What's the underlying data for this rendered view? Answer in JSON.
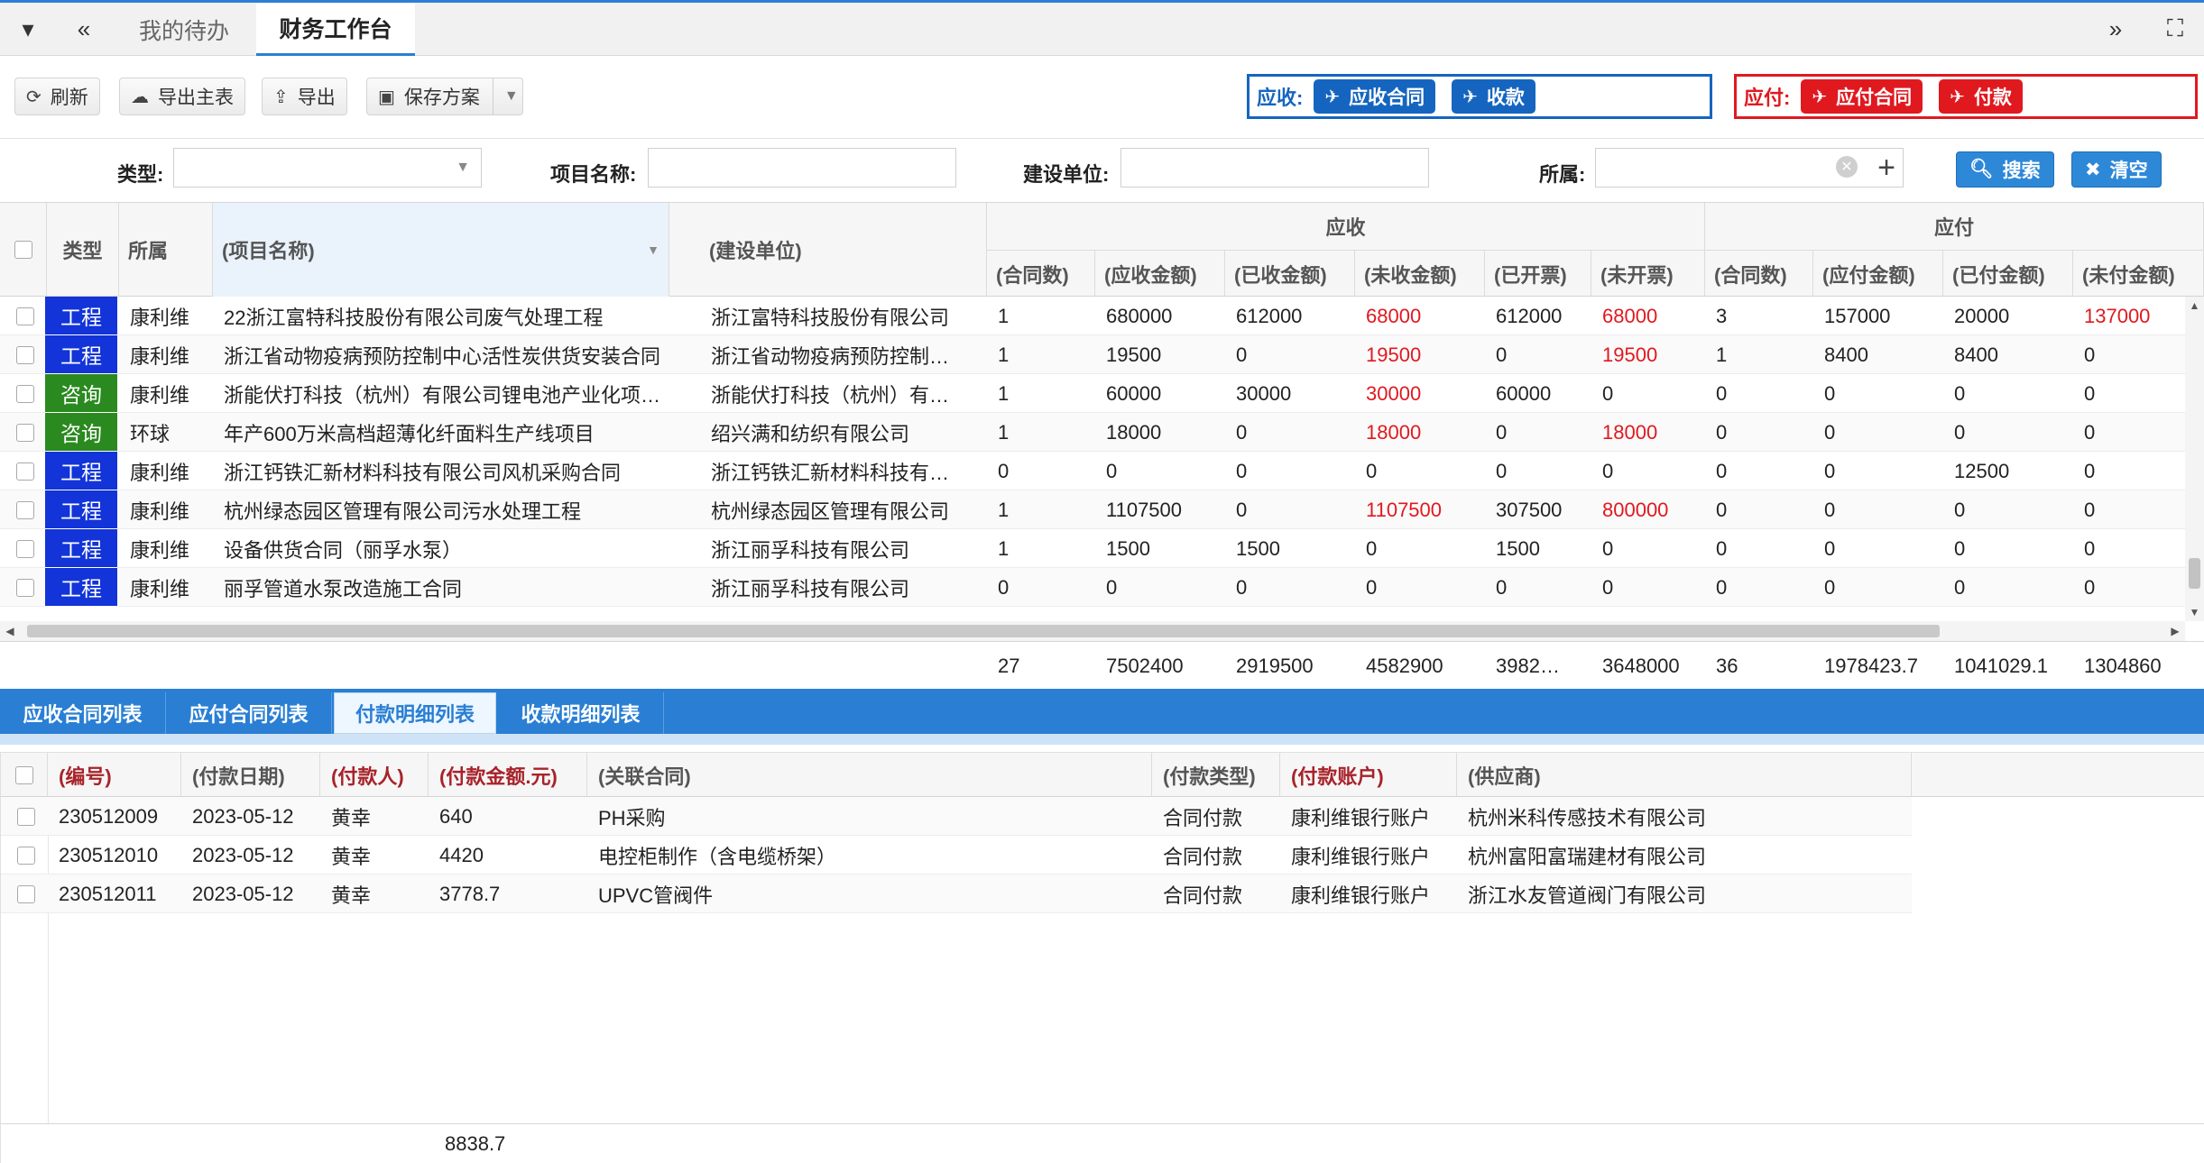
{
  "topbar": {
    "tabs": [
      {
        "label": "我的待办",
        "active": false
      },
      {
        "label": "财务工作台",
        "active": true
      }
    ]
  },
  "toolbar": {
    "refresh": "刷新",
    "export_main": "导出主表",
    "export": "导出",
    "save_plan": "保存方案",
    "receivable_group": {
      "label": "应收:",
      "contract_btn": "应收合同",
      "collect_btn": "收款"
    },
    "payable_group": {
      "label": "应付:",
      "contract_btn": "应付合同",
      "pay_btn": "付款"
    },
    "colors": {
      "receivable": "#1565c0",
      "payable": "#e0191f"
    }
  },
  "search": {
    "type_label": "类型:",
    "type_value": "",
    "project_label": "项目名称:",
    "project_value": "",
    "builder_label": "建设单位:",
    "builder_value": "",
    "belong_label": "所属:",
    "belong_value": "",
    "search_btn": "搜索",
    "clear_btn": "清空"
  },
  "grid1": {
    "headers": {
      "type": "类型",
      "belong": "所属",
      "project": "(项目名称)",
      "builder": "(建设单位)",
      "receivable_group": "应收",
      "payable_group": "应付",
      "r_count": "(合同数)",
      "r_amount": "(应收金额)",
      "r_received": "(已收金额)",
      "r_unreceived": "(未收金额)",
      "r_invoiced": "(已开票)",
      "r_uninvoiced": "(未开票)",
      "p_count": "(合同数)",
      "p_amount": "(应付金额)",
      "p_paid": "(已付金额)",
      "p_unpaid": "(未付金额)"
    },
    "rows": [
      {
        "type": "工程",
        "belong": "康利维",
        "project": "22浙江富特科技股份有限公司废气处理工程",
        "builder": "浙江富特科技股份有限公司",
        "r_count": "1",
        "r_amount": "680000",
        "r_received": "612000",
        "r_unreceived": "68000",
        "r_invoiced": "612000",
        "r_uninvoiced": "68000",
        "p_count": "3",
        "p_amount": "157000",
        "p_paid": "20000",
        "p_unpaid": "137000",
        "unrec_red": true,
        "uninv_red": true,
        "unpaid_red": true
      },
      {
        "type": "工程",
        "belong": "康利维",
        "project": "浙江省动物疫病预防控制中心活性炭供货安装合同",
        "builder": "浙江省动物疫病预防控制…",
        "r_count": "1",
        "r_amount": "19500",
        "r_received": "0",
        "r_unreceived": "19500",
        "r_invoiced": "0",
        "r_uninvoiced": "19500",
        "p_count": "1",
        "p_amount": "8400",
        "p_paid": "8400",
        "p_unpaid": "0",
        "unrec_red": true,
        "uninv_red": true,
        "unpaid_red": false
      },
      {
        "type": "咨询",
        "belong": "康利维",
        "project": "浙能伏打科技（杭州）有限公司锂电池产业化项…",
        "builder": "浙能伏打科技（杭州）有…",
        "r_count": "1",
        "r_amount": "60000",
        "r_received": "30000",
        "r_unreceived": "30000",
        "r_invoiced": "60000",
        "r_uninvoiced": "0",
        "p_count": "0",
        "p_amount": "0",
        "p_paid": "0",
        "p_unpaid": "0",
        "unrec_red": true,
        "uninv_red": false,
        "unpaid_red": false
      },
      {
        "type": "咨询",
        "belong": "环球",
        "project": "年产600万米高档超薄化纤面料生产线项目",
        "builder": "绍兴满和纺织有限公司",
        "r_count": "1",
        "r_amount": "18000",
        "r_received": "0",
        "r_unreceived": "18000",
        "r_invoiced": "0",
        "r_uninvoiced": "18000",
        "p_count": "0",
        "p_amount": "0",
        "p_paid": "0",
        "p_unpaid": "0",
        "unrec_red": true,
        "uninv_red": true,
        "unpaid_red": false
      },
      {
        "type": "工程",
        "belong": "康利维",
        "project": "浙江钙铁汇新材料科技有限公司风机采购合同",
        "builder": "浙江钙铁汇新材料科技有…",
        "r_count": "0",
        "r_amount": "0",
        "r_received": "0",
        "r_unreceived": "0",
        "r_invoiced": "0",
        "r_uninvoiced": "0",
        "p_count": "0",
        "p_amount": "0",
        "p_paid": "12500",
        "p_unpaid": "0",
        "unrec_red": false,
        "uninv_red": false,
        "unpaid_red": false
      },
      {
        "type": "工程",
        "belong": "康利维",
        "project": "杭州绿态园区管理有限公司污水处理工程",
        "builder": "杭州绿态园区管理有限公司",
        "r_count": "1",
        "r_amount": "1107500",
        "r_received": "0",
        "r_unreceived": "1107500",
        "r_invoiced": "307500",
        "r_uninvoiced": "800000",
        "p_count": "0",
        "p_amount": "0",
        "p_paid": "0",
        "p_unpaid": "0",
        "unrec_red": true,
        "uninv_red": true,
        "unpaid_red": false
      },
      {
        "type": "工程",
        "belong": "康利维",
        "project": "设备供货合同（丽孚水泵）",
        "builder": "浙江丽孚科技有限公司",
        "r_count": "1",
        "r_amount": "1500",
        "r_received": "1500",
        "r_unreceived": "0",
        "r_invoiced": "1500",
        "r_uninvoiced": "0",
        "p_count": "0",
        "p_amount": "0",
        "p_paid": "0",
        "p_unpaid": "0",
        "unrec_red": false,
        "uninv_red": false,
        "unpaid_red": false
      },
      {
        "type": "工程",
        "belong": "康利维",
        "project": "丽孚管道水泵改造施工合同",
        "builder": "浙江丽孚科技有限公司",
        "r_count": "0",
        "r_amount": "0",
        "r_received": "0",
        "r_unreceived": "0",
        "r_invoiced": "0",
        "r_uninvoiced": "0",
        "p_count": "0",
        "p_amount": "0",
        "p_paid": "0",
        "p_unpaid": "0",
        "unrec_red": false,
        "uninv_red": false,
        "unpaid_red": false
      }
    ],
    "totals": {
      "r_count": "27",
      "r_amount": "7502400",
      "r_received": "2919500",
      "r_unreceived": "4582900",
      "r_invoiced": "3982…",
      "r_uninvoiced": "3648000",
      "p_count": "36",
      "p_amount": "1978423.7",
      "p_paid": "1041029.1",
      "p_unpaid": "1304860"
    }
  },
  "bottom_tabs": [
    {
      "label": "应收合同列表",
      "active": false
    },
    {
      "label": "应付合同列表",
      "active": false
    },
    {
      "label": "付款明细列表",
      "active": true
    },
    {
      "label": "收款明细列表",
      "active": false
    }
  ],
  "grid2": {
    "headers": {
      "no": "(编号)",
      "date": "(付款日期)",
      "payer": "(付款人)",
      "amount": "(付款金额.元)",
      "contract": "(关联合同)",
      "pay_type": "(付款类型)",
      "account": "(付款账户)",
      "supplier": "(供应商)"
    },
    "rows": [
      {
        "no": "230512009",
        "date": "2023-05-12",
        "payer": "黄幸",
        "amount": "640",
        "contract": "PH采购",
        "pay_type": "合同付款",
        "account": "康利维银行账户",
        "supplier": "杭州米科传感技术有限公司"
      },
      {
        "no": "230512010",
        "date": "2023-05-12",
        "payer": "黄幸",
        "amount": "4420",
        "contract": "电控柜制作（含电缆桥架）",
        "pay_type": "合同付款",
        "account": "康利维银行账户",
        "supplier": "杭州富阳富瑞建材有限公司"
      },
      {
        "no": "230512011",
        "date": "2023-05-12",
        "payer": "黄幸",
        "amount": "3778.7",
        "contract": "UPVC管阀件",
        "pay_type": "合同付款",
        "account": "康利维银行账户",
        "supplier": "浙江水友管道阀门有限公司"
      }
    ],
    "total_amount": "8838.7"
  }
}
